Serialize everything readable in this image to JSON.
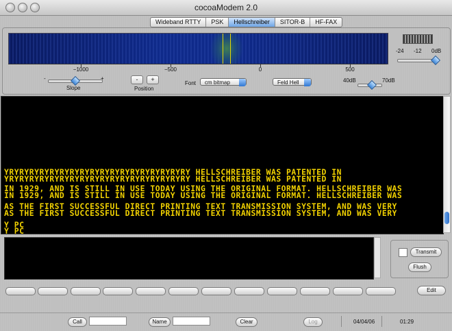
{
  "window": {
    "title": "cocoaModem 2.0"
  },
  "tabs": [
    {
      "label": "Wideband RTTY",
      "active": false
    },
    {
      "label": "PSK",
      "active": false
    },
    {
      "label": "Hellschreiber",
      "active": true
    },
    {
      "label": "SITOR-B",
      "active": false
    },
    {
      "label": "HF-FAX",
      "active": false
    }
  ],
  "spectrum": {
    "ticks": [
      "−1000",
      "−500",
      "0",
      "500"
    ]
  },
  "level": {
    "labels": [
      "-24",
      "-12",
      "0dB"
    ]
  },
  "controls": {
    "slope_label": "Slope",
    "slope_minus": "-",
    "slope_plus": "+",
    "position_label": "Position",
    "position_minus": "-",
    "position_plus": "+",
    "font_label": "Font",
    "font_value": "cm bitmap",
    "mode_value": "Feld Hell",
    "range_min": "40dB",
    "range_max": "70dB"
  },
  "receive": {
    "lines": [
      "YRYRYRYRYRYRYRYRYRYRYRYRYRYRYRYRYRYRY  HELLSCHREIBER WAS PATENTED IN",
      "YRYRYRYRYRYRYRYRYRYRYRYRYRYRYRYRYRYRY  HELLSCHREIBER WAS PATENTED IN",
      " IN 1929, AND IS STILL IN USE  TODAY USING THE ORIGINAL FORMAT. HELLSCHREIBER WAS",
      " IN 1929, AND IS STILL IN USE  TODAY USING THE ORIGINAL FORMAT. HELLSCHREIBER WAS",
      "AS THE  FIRST SUCCESSFUL DIRECT PRINTING TEXT TRANSMISSION SYSTEM, AND WAS VERY",
      "AS THE  FIRST SUCCESSFUL DIRECT PRINTING TEXT TRANSMISSION SYSTEM, AND WAS VERY",
      "Y PC",
      "Y PC"
    ]
  },
  "side": {
    "transmit_label": "Transmit",
    "flush_label": "Flush"
  },
  "macros": {
    "edit_label": "Edit"
  },
  "footer": {
    "call_label": "Call",
    "call_value": "",
    "name_label": "Name",
    "name_value": "",
    "clear_label": "Clear",
    "log_label": "Log",
    "date": "04/04/06",
    "time": "01:29"
  }
}
